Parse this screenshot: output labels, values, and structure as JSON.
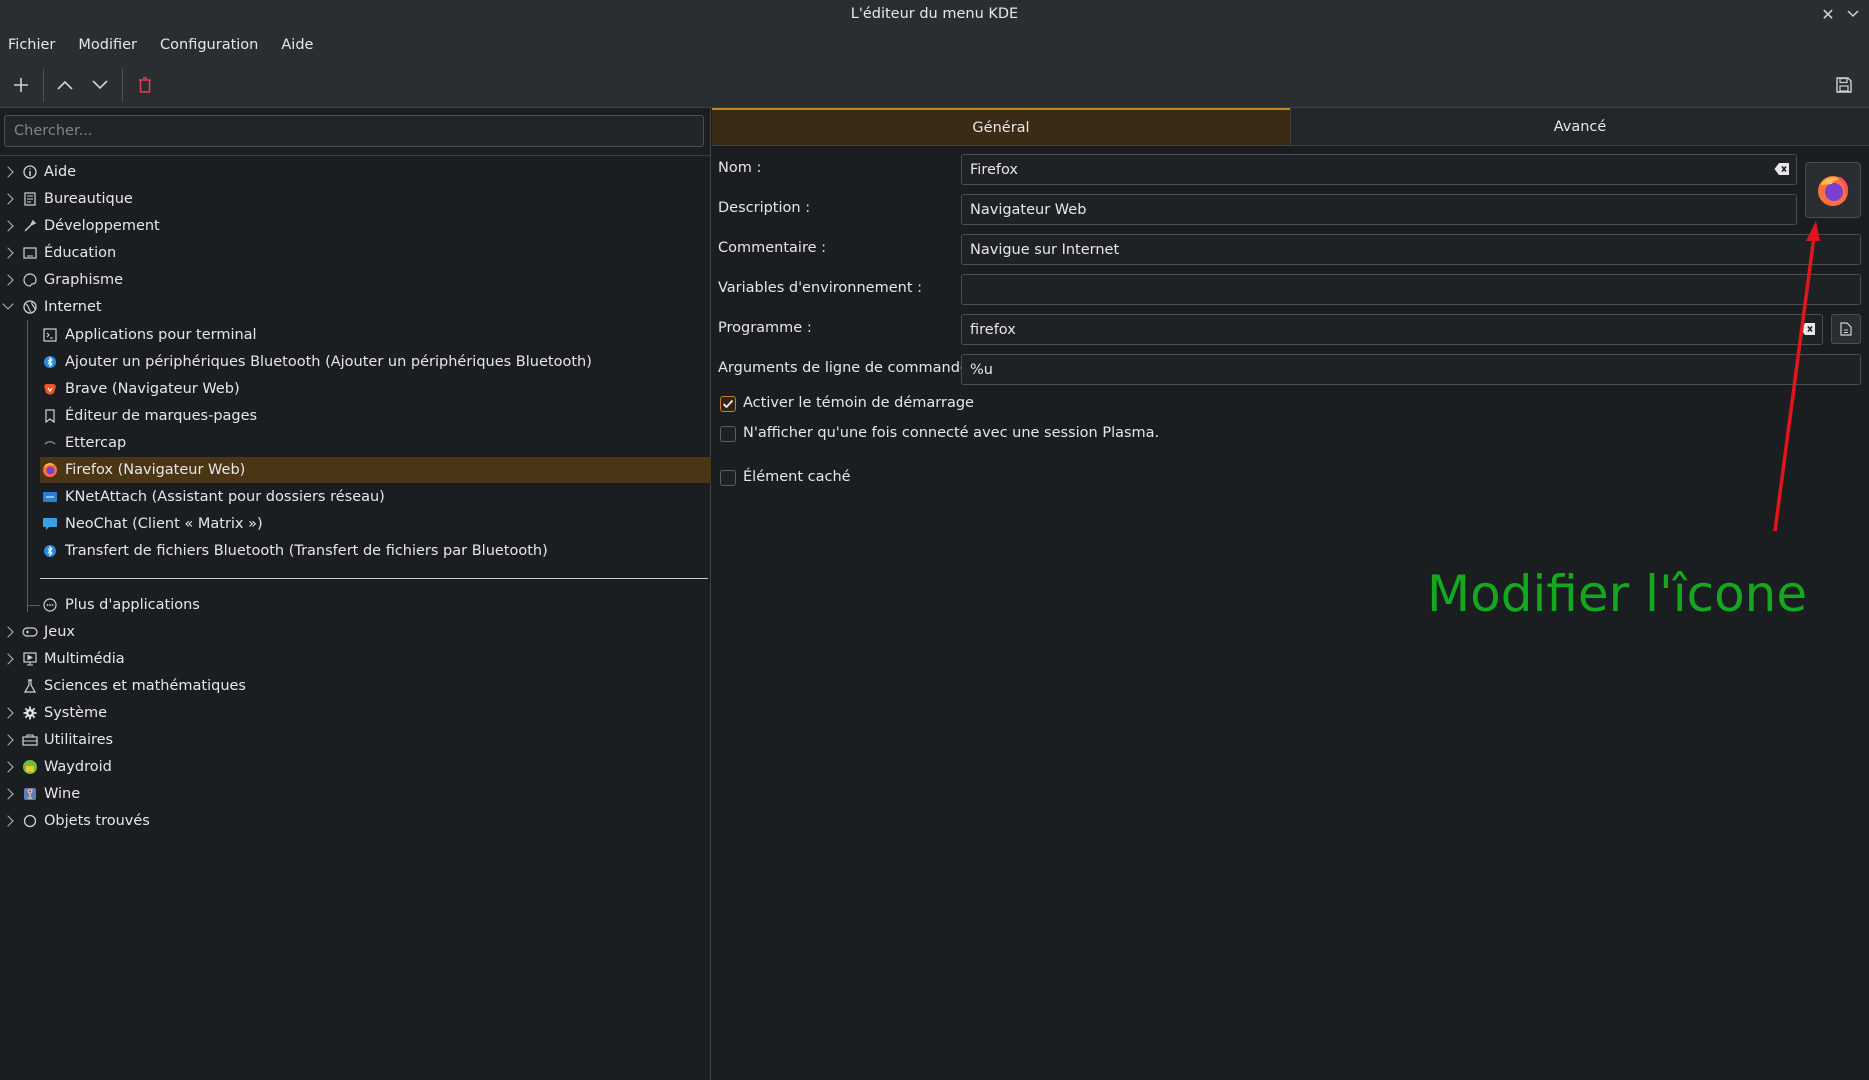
{
  "window": {
    "title": "L'éditeur du menu KDE"
  },
  "menubar": [
    "Fichier",
    "Modifier",
    "Configuration",
    "Aide"
  ],
  "search": {
    "placeholder": "Chercher..."
  },
  "tree": {
    "top_before": [
      {
        "label": "Aide",
        "icon": "info-icon"
      },
      {
        "label": "Bureautique",
        "icon": "office-icon"
      },
      {
        "label": "Développement",
        "icon": "tools-icon"
      },
      {
        "label": "Éducation",
        "icon": "education-icon"
      },
      {
        "label": "Graphisme",
        "icon": "palette-icon"
      },
      {
        "label": "Internet",
        "icon": "globe-icon"
      }
    ],
    "internet_children": [
      {
        "label": "Applications pour terminal",
        "icon": "terminal-icon"
      },
      {
        "label": "Ajouter un périphériques Bluetooth (Ajouter un périphériques Bluetooth)",
        "icon": "bluetooth-icon"
      },
      {
        "label": "Brave (Navigateur Web)",
        "icon": "brave-icon"
      },
      {
        "label": "Éditeur de marques-pages",
        "icon": "bookmark-icon"
      },
      {
        "label": "Ettercap",
        "icon": "ettercap-icon"
      },
      {
        "label": "Firefox (Navigateur Web)",
        "icon": "firefox-icon"
      },
      {
        "label": "KNetAttach (Assistant pour dossiers réseau)",
        "icon": "network-folder-icon"
      },
      {
        "label": "NeoChat (Client « Matrix »)",
        "icon": "chat-icon"
      },
      {
        "label": "Transfert de fichiers Bluetooth (Transfert de fichiers par Bluetooth)",
        "icon": "bluetooth-icon"
      }
    ],
    "more_apps": "Plus d'applications",
    "top_after": [
      {
        "label": "Jeux",
        "icon": "gamepad-icon"
      },
      {
        "label": "Multimédia",
        "icon": "multimedia-icon"
      },
      {
        "label": "Sciences et mathématiques",
        "icon": "flask-icon"
      },
      {
        "label": "Système",
        "icon": "gear-icon"
      },
      {
        "label": "Utilitaires",
        "icon": "toolbox-icon"
      },
      {
        "label": "Waydroid",
        "icon": "android-icon"
      },
      {
        "label": "Wine",
        "icon": "wine-icon"
      },
      {
        "label": "Objets trouvés",
        "icon": "circle-icon"
      }
    ]
  },
  "tabs": {
    "general": "Général",
    "advanced": "Avancé"
  },
  "form": {
    "name": {
      "label": "Nom :",
      "value": "Firefox"
    },
    "description": {
      "label": "Description :",
      "value": "Navigateur Web"
    },
    "comment": {
      "label": "Commentaire :",
      "value": "Navigue sur Internet"
    },
    "env": {
      "label": "Variables d'environnement :",
      "value": ""
    },
    "program": {
      "label": "Programme :",
      "value": "firefox"
    },
    "args": {
      "label": "Arguments de ligne de commandes :",
      "value": "%u"
    },
    "startup_feedback": {
      "label": "Activer le témoin de démarrage",
      "checked": true
    },
    "plasma_only": {
      "label": "N'afficher qu'une fois connecté avec une session Plasma.",
      "checked": false
    },
    "hidden": {
      "label": "Élément caché",
      "checked": false
    }
  },
  "annotation": {
    "text": "Modifier l'îcone",
    "color": "#13a81e",
    "arrow_color": "#e0161a"
  },
  "colors": {
    "selection": "#4a3514",
    "accent": "#c57f27"
  }
}
